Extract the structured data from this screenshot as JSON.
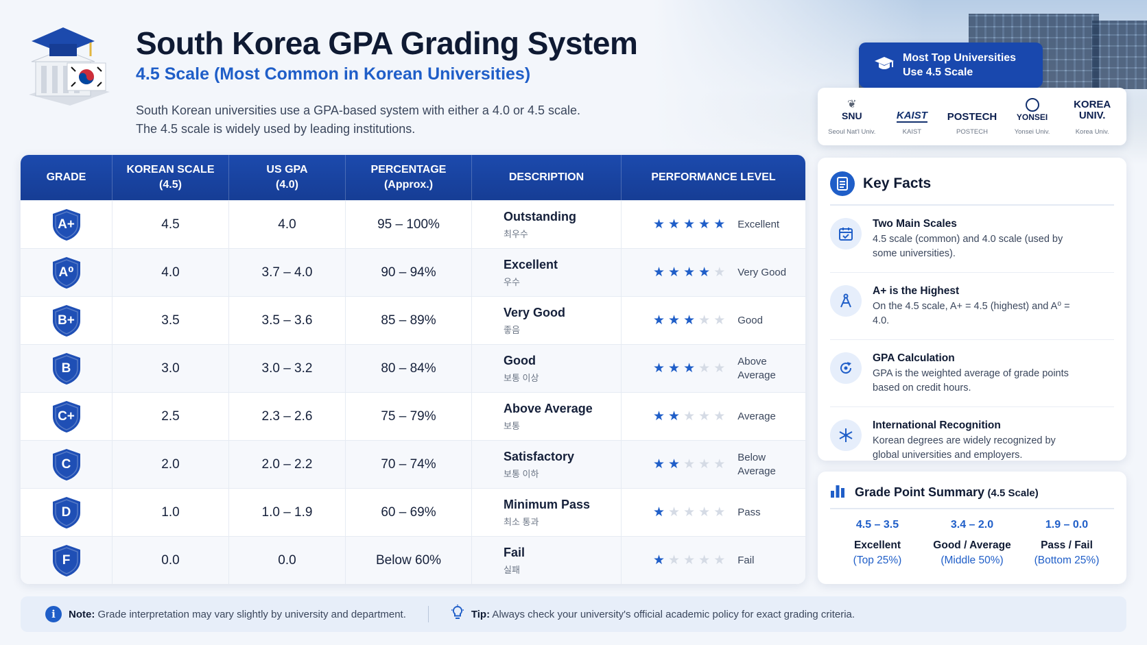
{
  "header": {
    "title": "South Korea GPA Grading System",
    "subtitle": "4.5 Scale (Most Common in Korean Universities)",
    "desc_line1": "South Korean universities use a GPA-based system with either a 4.0 or 4.5 scale.",
    "desc_line2": "The 4.5 scale is widely used by leading institutions."
  },
  "universities": {
    "banner_line1": "Most Top Universities",
    "banner_line2": "Use 4.5 Scale",
    "items": [
      {
        "mark": "SNU",
        "name": "Seoul Nat'l Univ."
      },
      {
        "mark": "KAIST",
        "name": "KAIST"
      },
      {
        "mark": "POSTECH",
        "name": "POSTECH"
      },
      {
        "mark": "YONSEI",
        "name": "Yonsei Univ."
      },
      {
        "mark_line1": "KOREA",
        "mark_line2": "UNIV.",
        "name": "Korea Univ."
      }
    ]
  },
  "table": {
    "headers": {
      "grade": "GRADE",
      "korean_1": "KOREAN SCALE",
      "korean_2": "(4.5)",
      "us_1": "US GPA",
      "us_2": "(4.0)",
      "pct_1": "PERCENTAGE",
      "pct_2": "(Approx.)",
      "desc": "DESCRIPTION",
      "perf": "PERFORMANCE LEVEL"
    },
    "rows": [
      {
        "grade": "A+",
        "korean": "4.5",
        "us": "4.0",
        "pct": "95 – 100%",
        "desc": "Outstanding",
        "desc_ko": "최우수",
        "stars": 5,
        "level": "Excellent"
      },
      {
        "grade": "A⁰",
        "korean": "4.0",
        "us": "3.7 – 4.0",
        "pct": "90 – 94%",
        "desc": "Excellent",
        "desc_ko": "우수",
        "stars": 4,
        "level": "Very Good"
      },
      {
        "grade": "B+",
        "korean": "3.5",
        "us": "3.5 – 3.6",
        "pct": "85 – 89%",
        "desc": "Very Good",
        "desc_ko": "좋음",
        "stars": 3,
        "level": "Good"
      },
      {
        "grade": "B",
        "korean": "3.0",
        "us": "3.0 – 3.2",
        "pct": "80 – 84%",
        "desc": "Good",
        "desc_ko": "보통 이상",
        "stars": 3,
        "level": "Above Average"
      },
      {
        "grade": "C+",
        "korean": "2.5",
        "us": "2.3 – 2.6",
        "pct": "75 – 79%",
        "desc": "Above Average",
        "desc_ko": "보통",
        "stars": 2,
        "level": "Average"
      },
      {
        "grade": "C",
        "korean": "2.0",
        "us": "2.0 – 2.2",
        "pct": "70 – 74%",
        "desc": "Satisfactory",
        "desc_ko": "보통 이하",
        "stars": 2,
        "level": "Below Average"
      },
      {
        "grade": "D",
        "korean": "1.0",
        "us": "1.0 – 1.9",
        "pct": "60 – 69%",
        "desc": "Minimum Pass",
        "desc_ko": "최소 통과",
        "stars": 1,
        "level": "Pass"
      },
      {
        "grade": "F",
        "korean": "0.0",
        "us": "0.0",
        "pct": "Below 60%",
        "desc": "Fail",
        "desc_ko": "실패",
        "stars": 1,
        "level": "Fail"
      }
    ]
  },
  "facts": {
    "title": "Key Facts",
    "items": [
      {
        "title": "Two Main Scales",
        "desc": "4.5 scale (common) and 4.0 scale (used by some universities).",
        "icon": "calendar-icon"
      },
      {
        "title": "A+ is the Highest",
        "desc": "On the 4.5 scale, A+ = 4.5 (highest) and A⁰ = 4.0.",
        "icon": "compass-icon"
      },
      {
        "title": "GPA Calculation",
        "desc": "GPA is the weighted average of grade points based on credit hours.",
        "icon": "refresh-icon"
      },
      {
        "title": "International Recognition",
        "desc": "Korean degrees are widely recognized by global universities and employers.",
        "icon": "network-icon"
      }
    ]
  },
  "summary": {
    "title": "Grade Point Summary",
    "scale": "(4.5 Scale)",
    "cols": [
      {
        "range": "4.5 – 3.5",
        "label": "Excellent",
        "share": "(Top 25%)"
      },
      {
        "range": "3.4 – 2.0",
        "label": "Good / Average",
        "share": "(Middle 50%)"
      },
      {
        "range": "1.9 – 0.0",
        "label": "Pass / Fail",
        "share": "(Bottom 25%)"
      }
    ]
  },
  "footer": {
    "note_label": "Note:",
    "note_text": " Grade interpretation may vary slightly by university and department.",
    "tip_label": "Tip:",
    "tip_text": " Always check your university's official academic policy for exact grading criteria."
  },
  "colors": {
    "primary": "#1c4aad",
    "accent": "#1f5ec8",
    "star_off": "#d5dbe5"
  }
}
